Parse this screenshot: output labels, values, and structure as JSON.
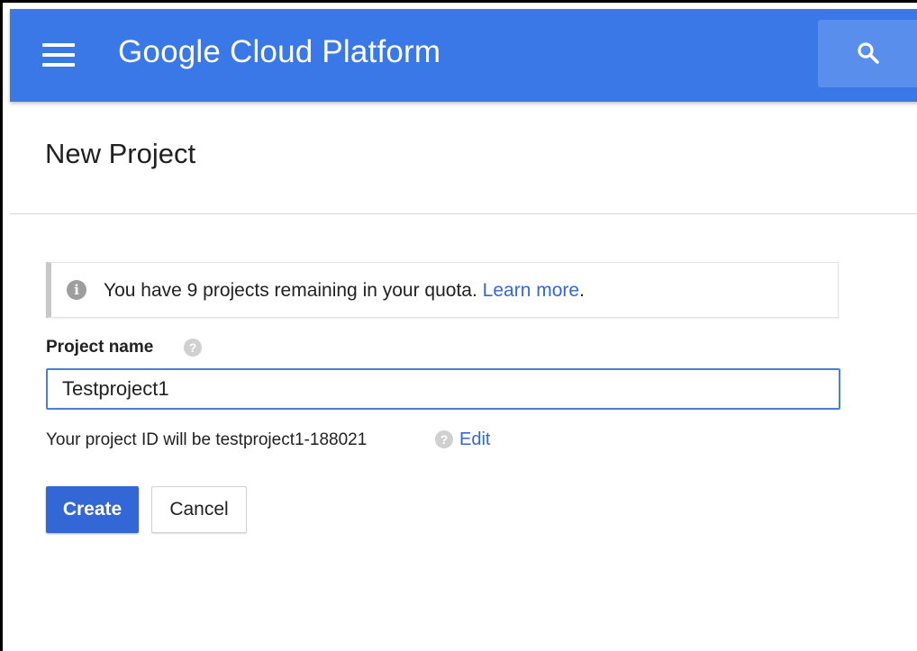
{
  "header": {
    "app_title": "Google Cloud Platform",
    "menu_icon": "hamburger-menu-icon",
    "search_icon": "search-icon",
    "bar_color": "#3b78e7"
  },
  "page": {
    "title": "New Project"
  },
  "quota_notice": {
    "icon": "info-icon",
    "icon_glyph": "i",
    "message": "You have 9 projects remaining in your quota.",
    "link_text": "Learn more",
    "trailing": "."
  },
  "project_name": {
    "label": "Project name",
    "help_glyph": "?",
    "value": "Testproject1"
  },
  "project_id": {
    "text": "Your project ID will be testproject1-188021",
    "help_glyph": "?",
    "edit_label": "Edit"
  },
  "actions": {
    "create_label": "Create",
    "cancel_label": "Cancel",
    "primary_color": "#3367d6"
  }
}
